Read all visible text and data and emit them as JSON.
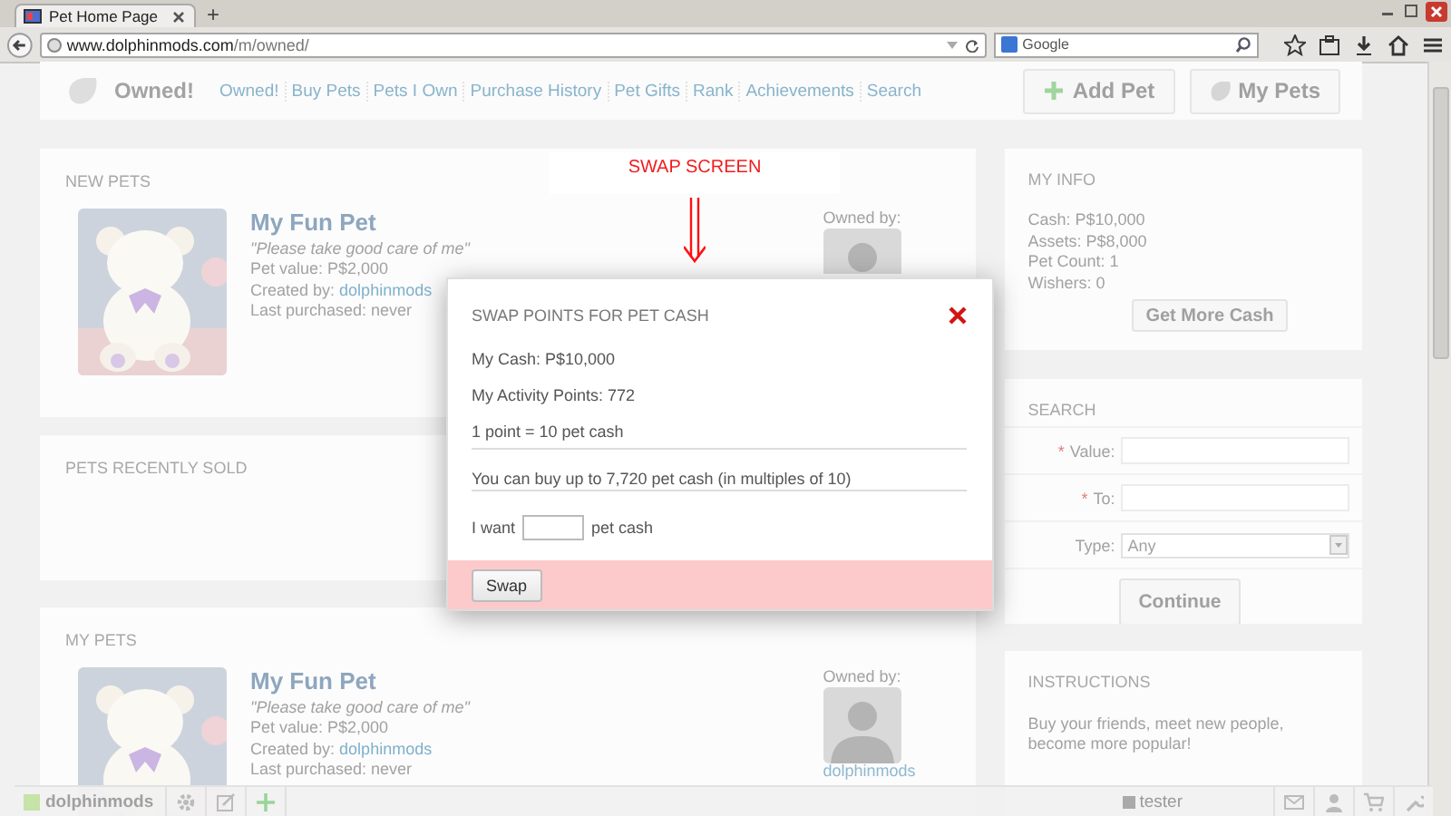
{
  "browser": {
    "tab_title": "Pet Home Page",
    "new_tab": "+",
    "url_host": "www.dolphinmods.com",
    "url_path": "/m/owned/",
    "search_placeholder": "Google"
  },
  "header": {
    "brand": "Owned!",
    "nav": [
      "Owned!",
      "Buy Pets",
      "Pets I Own",
      "Purchase History",
      "Pet Gifts",
      "Rank",
      "Achievements",
      "Search"
    ],
    "buttons": [
      {
        "label": "Add Pet",
        "kind": "add"
      },
      {
        "label": "My Pets",
        "kind": "pets"
      }
    ]
  },
  "sections": [
    {
      "title": "NEW PETS",
      "pets": [
        {
          "name": "My Fun Pet",
          "quote": "\"Please take good care of me\"",
          "value": "Pet value: P$2,000",
          "created_label": "Created by:",
          "creator": "dolphinmods",
          "last_purchased": "Last purchased: never",
          "owned_label": "Owned by:"
        }
      ]
    },
    {
      "title": "PETS RECENTLY SOLD"
    },
    {
      "title": "MY PETS",
      "pets": [
        {
          "name": "My Fun Pet",
          "quote": "\"Please take good care of me\"",
          "value": "Pet value: P$2,000",
          "created_label": "Created by:",
          "creator": "dolphinmods",
          "last_purchased": "Last purchased: never",
          "owned_label": "Owned by:",
          "owner": "dolphinmods"
        }
      ]
    }
  ],
  "sidebar": {
    "my_info": {
      "title": "MY INFO",
      "lines": [
        "Cash: P$10,000",
        "Assets: P$8,000",
        "Pet Count: 1",
        "Wishers: 0"
      ],
      "button": "Get More Cash"
    },
    "search": {
      "title": "SEARCH",
      "fields": [
        {
          "kind": "text",
          "required_mark": "*",
          "label": "Value:"
        },
        {
          "kind": "text",
          "required_mark": "*",
          "label": "To:"
        },
        {
          "kind": "select",
          "label": "Type:",
          "value": "Any"
        }
      ],
      "button": "Continue"
    },
    "instructions": {
      "title": "INSTRUCTIONS",
      "text": "Buy your friends, meet new people, become more popular!"
    }
  },
  "annotation": {
    "label": "SWAP SCREEN"
  },
  "modal": {
    "title": "SWAP POINTS FOR PET CASH",
    "lines": [
      "My Cash: P$10,000",
      "My Activity Points: 772",
      "1 point = 10 pet cash"
    ],
    "note": "You can buy up to 7,720 pet cash (in multiples of 10)",
    "want_prefix": "I want",
    "want_suffix": "pet cash",
    "button": "Swap"
  },
  "bottom_bar": {
    "user": "dolphinmods",
    "right_user": "tester"
  }
}
